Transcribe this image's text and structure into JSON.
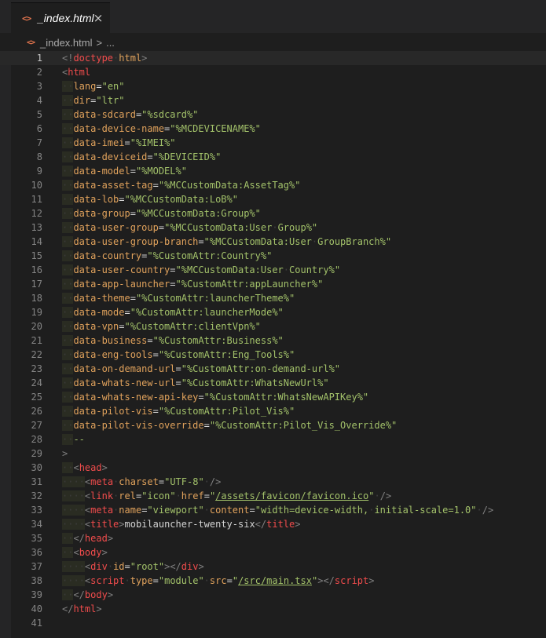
{
  "tab": {
    "icon": "html-file-icon",
    "label": "_index.html",
    "close": "×"
  },
  "breadcrumb": {
    "file": "_index.html",
    "separator": ">",
    "more": "..."
  },
  "colors": {
    "tag": "#f14c4c",
    "attribute": "#e0a25c",
    "string": "#a3c26a",
    "background": "#1e1e1e"
  },
  "editor": {
    "current_line": 1,
    "lines": [
      {
        "n": "1",
        "indent": 0,
        "tokens": [
          [
            "t-punc",
            "<!"
          ],
          [
            "t-doctype",
            "doctype"
          ],
          [
            "dot",
            "·"
          ],
          [
            "t-attr",
            "html"
          ],
          [
            "t-punc",
            ">"
          ]
        ]
      },
      {
        "n": "2",
        "indent": 0,
        "tokens": [
          [
            "t-punc",
            "<"
          ],
          [
            "t-tag",
            "html"
          ]
        ]
      },
      {
        "n": "3",
        "indent": 1,
        "tokens": [
          [
            "t-attr",
            "lang"
          ],
          [
            "t-eq",
            "="
          ],
          [
            "t-str",
            "\"en\""
          ]
        ]
      },
      {
        "n": "4",
        "indent": 1,
        "tokens": [
          [
            "t-attr",
            "dir"
          ],
          [
            "t-eq",
            "="
          ],
          [
            "t-str",
            "\"ltr\""
          ]
        ]
      },
      {
        "n": "5",
        "indent": 1,
        "tokens": [
          [
            "t-attr",
            "data-sdcard"
          ],
          [
            "t-eq",
            "="
          ],
          [
            "t-str",
            "\"%sdcard%\""
          ]
        ]
      },
      {
        "n": "6",
        "indent": 1,
        "tokens": [
          [
            "t-attr",
            "data-device-name"
          ],
          [
            "t-eq",
            "="
          ],
          [
            "t-str",
            "\"%MCDEVICENAME%\""
          ]
        ]
      },
      {
        "n": "7",
        "indent": 1,
        "tokens": [
          [
            "t-attr",
            "data-imei"
          ],
          [
            "t-eq",
            "="
          ],
          [
            "t-str",
            "\"%IMEI%\""
          ]
        ]
      },
      {
        "n": "8",
        "indent": 1,
        "tokens": [
          [
            "t-attr",
            "data-deviceid"
          ],
          [
            "t-eq",
            "="
          ],
          [
            "t-str",
            "\"%DEVICEID%\""
          ]
        ]
      },
      {
        "n": "9",
        "indent": 1,
        "tokens": [
          [
            "t-attr",
            "data-model"
          ],
          [
            "t-eq",
            "="
          ],
          [
            "t-str",
            "\"%MODEL%\""
          ]
        ]
      },
      {
        "n": "10",
        "indent": 1,
        "tokens": [
          [
            "t-attr",
            "data-asset-tag"
          ],
          [
            "t-eq",
            "="
          ],
          [
            "t-str",
            "\"%MCCustomData:AssetTag%\""
          ]
        ]
      },
      {
        "n": "11",
        "indent": 1,
        "tokens": [
          [
            "t-attr",
            "data-lob"
          ],
          [
            "t-eq",
            "="
          ],
          [
            "t-str",
            "\"%MCCustomData:LoB%\""
          ]
        ]
      },
      {
        "n": "12",
        "indent": 1,
        "tokens": [
          [
            "t-attr",
            "data-group"
          ],
          [
            "t-eq",
            "="
          ],
          [
            "t-str",
            "\"%MCCustomData:Group%\""
          ]
        ]
      },
      {
        "n": "13",
        "indent": 1,
        "tokens": [
          [
            "t-attr",
            "data-user-group"
          ],
          [
            "t-eq",
            "="
          ],
          [
            "t-str",
            "\"%MCCustomData:User"
          ],
          [
            "dot",
            "·"
          ],
          [
            "t-str",
            "Group%\""
          ]
        ]
      },
      {
        "n": "14",
        "indent": 1,
        "tokens": [
          [
            "t-attr",
            "data-user-group-branch"
          ],
          [
            "t-eq",
            "="
          ],
          [
            "t-str",
            "\"%MCCustomData:User"
          ],
          [
            "dot",
            "·"
          ],
          [
            "t-str",
            "GroupBranch%\""
          ]
        ]
      },
      {
        "n": "15",
        "indent": 1,
        "tokens": [
          [
            "t-attr",
            "data-country"
          ],
          [
            "t-eq",
            "="
          ],
          [
            "t-str",
            "\"%CustomAttr:Country%\""
          ]
        ]
      },
      {
        "n": "16",
        "indent": 1,
        "tokens": [
          [
            "t-attr",
            "data-user-country"
          ],
          [
            "t-eq",
            "="
          ],
          [
            "t-str",
            "\"%MCCustomData:User"
          ],
          [
            "dot",
            "·"
          ],
          [
            "t-str",
            "Country%\""
          ]
        ]
      },
      {
        "n": "17",
        "indent": 1,
        "tokens": [
          [
            "t-attr",
            "data-app-launcher"
          ],
          [
            "t-eq",
            "="
          ],
          [
            "t-str",
            "\"%CustomAttr:appLauncher%\""
          ]
        ]
      },
      {
        "n": "18",
        "indent": 1,
        "tokens": [
          [
            "t-attr",
            "data-theme"
          ],
          [
            "t-eq",
            "="
          ],
          [
            "t-str",
            "\"%CustomAttr:launcherTheme%\""
          ]
        ]
      },
      {
        "n": "19",
        "indent": 1,
        "tokens": [
          [
            "t-attr",
            "data-mode"
          ],
          [
            "t-eq",
            "="
          ],
          [
            "t-str",
            "\"%CustomAttr:launcherMode%\""
          ]
        ]
      },
      {
        "n": "20",
        "indent": 1,
        "tokens": [
          [
            "t-attr",
            "data-vpn"
          ],
          [
            "t-eq",
            "="
          ],
          [
            "t-str",
            "\"%CustomAttr:clientVpn%\""
          ]
        ]
      },
      {
        "n": "21",
        "indent": 1,
        "tokens": [
          [
            "t-attr",
            "data-business"
          ],
          [
            "t-eq",
            "="
          ],
          [
            "t-str",
            "\"%CustomAttr:Business%\""
          ]
        ]
      },
      {
        "n": "22",
        "indent": 1,
        "tokens": [
          [
            "t-attr",
            "data-eng-tools"
          ],
          [
            "t-eq",
            "="
          ],
          [
            "t-str",
            "\"%CustomAttr:Eng_Tools%\""
          ]
        ]
      },
      {
        "n": "23",
        "indent": 1,
        "tokens": [
          [
            "t-attr",
            "data-on-demand-url"
          ],
          [
            "t-eq",
            "="
          ],
          [
            "t-str",
            "\"%CustomAttr:on-demand-url%\""
          ]
        ]
      },
      {
        "n": "24",
        "indent": 1,
        "tokens": [
          [
            "t-attr",
            "data-whats-new-url"
          ],
          [
            "t-eq",
            "="
          ],
          [
            "t-str",
            "\"%CustomAttr:WhatsNewUrl%\""
          ]
        ]
      },
      {
        "n": "25",
        "indent": 1,
        "tokens": [
          [
            "t-attr",
            "data-whats-new-api-key"
          ],
          [
            "t-eq",
            "="
          ],
          [
            "t-str",
            "\"%CustomAttr:WhatsNewAPIKey%\""
          ]
        ]
      },
      {
        "n": "26",
        "indent": 1,
        "tokens": [
          [
            "t-attr",
            "data-pilot-vis"
          ],
          [
            "t-eq",
            "="
          ],
          [
            "t-str",
            "\"%CustomAttr:Pilot_Vis%\""
          ]
        ]
      },
      {
        "n": "27",
        "indent": 1,
        "tokens": [
          [
            "t-attr",
            "data-pilot-vis-override"
          ],
          [
            "t-eq",
            "="
          ],
          [
            "t-str",
            "\"%CustomAttr:Pilot_Vis_Override%\""
          ]
        ]
      },
      {
        "n": "28",
        "indent": 1,
        "tokens": [
          [
            "t-dash",
            "--"
          ]
        ]
      },
      {
        "n": "29",
        "indent": 0,
        "tokens": [
          [
            "t-punc",
            ">"
          ]
        ]
      },
      {
        "n": "30",
        "indent": 1,
        "tokens": [
          [
            "t-punc",
            "<"
          ],
          [
            "t-tag",
            "head"
          ],
          [
            "t-punc",
            ">"
          ]
        ]
      },
      {
        "n": "31",
        "indent": 2,
        "tokens": [
          [
            "t-punc",
            "<"
          ],
          [
            "t-tag",
            "meta"
          ],
          [
            "dot",
            "·"
          ],
          [
            "t-attr",
            "charset"
          ],
          [
            "t-eq",
            "="
          ],
          [
            "t-str",
            "\"UTF-8\""
          ],
          [
            "dot",
            "·"
          ],
          [
            "t-punc",
            "/>"
          ]
        ]
      },
      {
        "n": "32",
        "indent": 2,
        "tokens": [
          [
            "t-punc",
            "<"
          ],
          [
            "t-tag",
            "link"
          ],
          [
            "dot",
            "·"
          ],
          [
            "t-attr",
            "rel"
          ],
          [
            "t-eq",
            "="
          ],
          [
            "t-str",
            "\"icon\""
          ],
          [
            "dot",
            "·"
          ],
          [
            "t-attr",
            "href"
          ],
          [
            "t-eq",
            "="
          ],
          [
            "t-str",
            "\""
          ],
          [
            "t-link",
            "/assets/favicon/favicon.ico"
          ],
          [
            "t-str",
            "\""
          ],
          [
            "dot",
            "·"
          ],
          [
            "t-punc",
            "/>"
          ]
        ]
      },
      {
        "n": "33",
        "indent": 2,
        "tokens": [
          [
            "t-punc",
            "<"
          ],
          [
            "t-tag",
            "meta"
          ],
          [
            "dot",
            "·"
          ],
          [
            "t-attr",
            "name"
          ],
          [
            "t-eq",
            "="
          ],
          [
            "t-str",
            "\"viewport\""
          ],
          [
            "dot",
            "·"
          ],
          [
            "t-attr",
            "content"
          ],
          [
            "t-eq",
            "="
          ],
          [
            "t-str",
            "\"width=device-width,"
          ],
          [
            "dot",
            "·"
          ],
          [
            "t-str",
            "initial-scale=1.0\""
          ],
          [
            "dot",
            "·"
          ],
          [
            "t-punc",
            "/>"
          ]
        ]
      },
      {
        "n": "34",
        "indent": 2,
        "tokens": [
          [
            "t-punc",
            "<"
          ],
          [
            "t-tag",
            "title"
          ],
          [
            "t-punc",
            ">"
          ],
          [
            "t-text",
            "mobilauncher-twenty-six"
          ],
          [
            "t-punc",
            "</"
          ],
          [
            "t-tag",
            "title"
          ],
          [
            "t-punc",
            ">"
          ]
        ]
      },
      {
        "n": "35",
        "indent": 1,
        "tokens": [
          [
            "t-punc",
            "</"
          ],
          [
            "t-tag",
            "head"
          ],
          [
            "t-punc",
            ">"
          ]
        ]
      },
      {
        "n": "36",
        "indent": 1,
        "tokens": [
          [
            "t-punc",
            "<"
          ],
          [
            "t-tag",
            "body"
          ],
          [
            "t-punc",
            ">"
          ]
        ]
      },
      {
        "n": "37",
        "indent": 2,
        "tokens": [
          [
            "t-punc",
            "<"
          ],
          [
            "t-tag",
            "div"
          ],
          [
            "dot",
            "·"
          ],
          [
            "t-attr",
            "id"
          ],
          [
            "t-eq",
            "="
          ],
          [
            "t-str",
            "\"root\""
          ],
          [
            "t-punc",
            "></"
          ],
          [
            "t-tag",
            "div"
          ],
          [
            "t-punc",
            ">"
          ]
        ]
      },
      {
        "n": "38",
        "indent": 2,
        "tokens": [
          [
            "t-punc",
            "<"
          ],
          [
            "t-tag",
            "script"
          ],
          [
            "dot",
            "·"
          ],
          [
            "t-attr",
            "type"
          ],
          [
            "t-eq",
            "="
          ],
          [
            "t-str",
            "\"module\""
          ],
          [
            "dot",
            "·"
          ],
          [
            "t-attr",
            "src"
          ],
          [
            "t-eq",
            "="
          ],
          [
            "t-str",
            "\""
          ],
          [
            "t-link",
            "/src/main.tsx"
          ],
          [
            "t-str",
            "\""
          ],
          [
            "t-punc",
            "></"
          ],
          [
            "t-tag",
            "script"
          ],
          [
            "t-punc",
            ">"
          ]
        ]
      },
      {
        "n": "39",
        "indent": 1,
        "tokens": [
          [
            "t-punc",
            "</"
          ],
          [
            "t-tag",
            "body"
          ],
          [
            "t-punc",
            ">"
          ]
        ]
      },
      {
        "n": "40",
        "indent": 0,
        "tokens": [
          [
            "t-punc",
            "</"
          ],
          [
            "t-tag",
            "html"
          ],
          [
            "t-punc",
            ">"
          ]
        ]
      },
      {
        "n": "41",
        "indent": 0,
        "tokens": []
      }
    ]
  }
}
